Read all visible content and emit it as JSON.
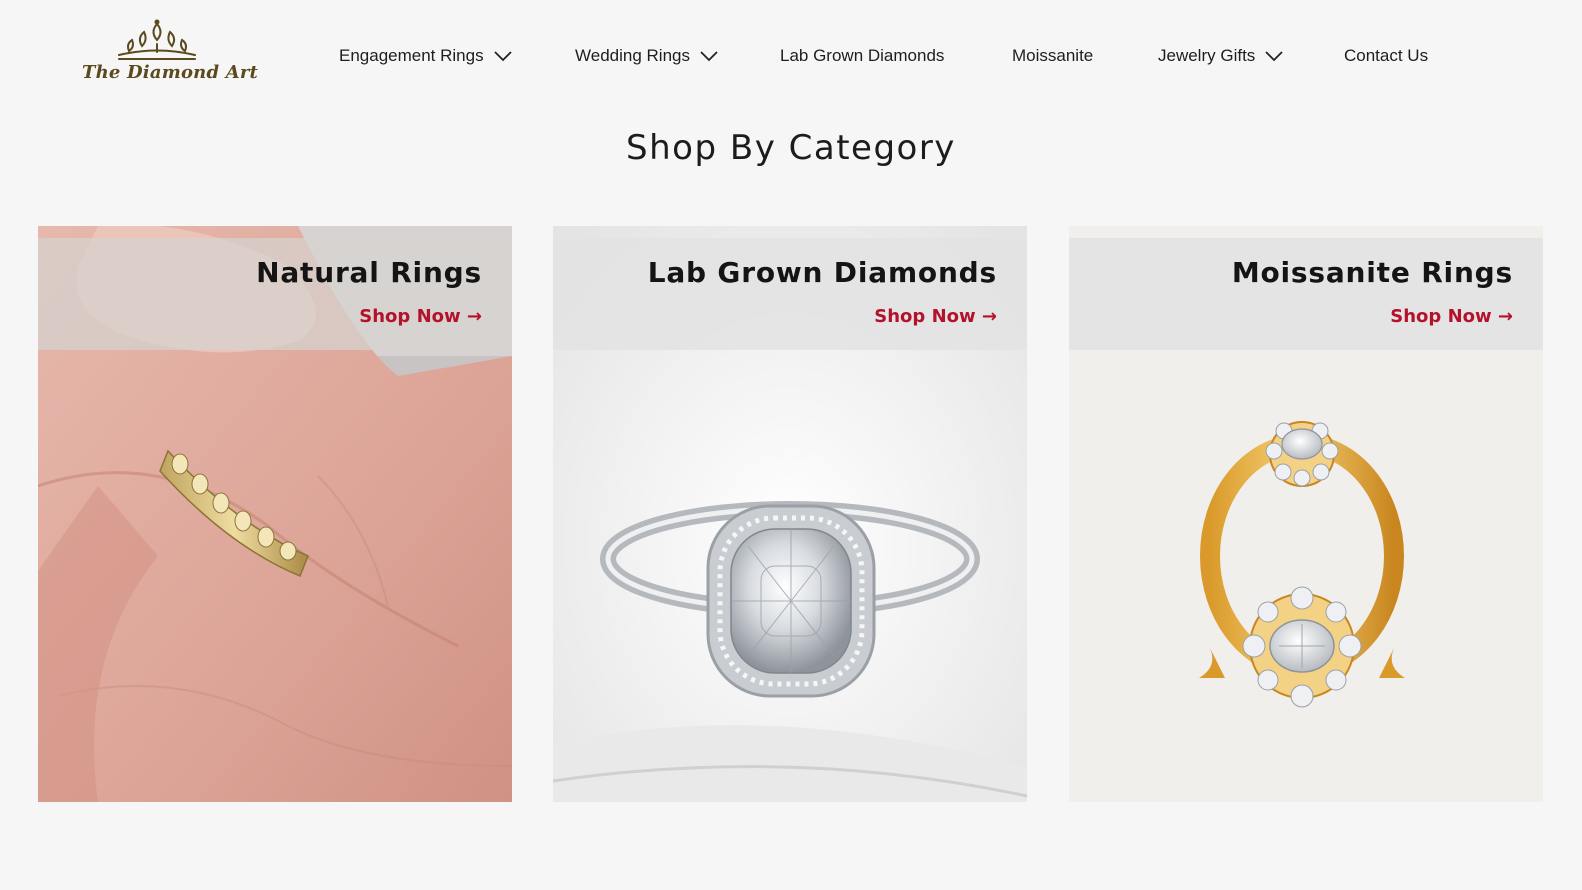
{
  "brand": {
    "name": "The Diamond Art",
    "logo_color": "#5b4a1e"
  },
  "nav": {
    "items": [
      {
        "label": "Engagement Rings",
        "has_dropdown": true
      },
      {
        "label": "Wedding Rings",
        "has_dropdown": true
      },
      {
        "label": "Lab Grown Diamonds",
        "has_dropdown": false
      },
      {
        "label": "Moissanite",
        "has_dropdown": false
      },
      {
        "label": "Jewelry Gifts",
        "has_dropdown": true
      },
      {
        "label": "Contact Us",
        "has_dropdown": false
      }
    ],
    "dropdown_icon": "chevron-down-icon"
  },
  "section": {
    "title": "Shop By Category"
  },
  "categories": [
    {
      "title": "Natural Rings",
      "cta": "Shop Now →",
      "image": "gold-chain-ring-on-finger"
    },
    {
      "title": "Lab Grown Diamonds",
      "cta": "Shop Now →",
      "image": "cushion-halo-diamond-ring"
    },
    {
      "title": "Moissanite Rings",
      "cta": "Shop Now →",
      "image": "gold-cluster-moissanite-ring"
    }
  ],
  "colors": {
    "accent": "#b3122a",
    "background": "#f6f6f6",
    "text": "#1b1b1b"
  }
}
